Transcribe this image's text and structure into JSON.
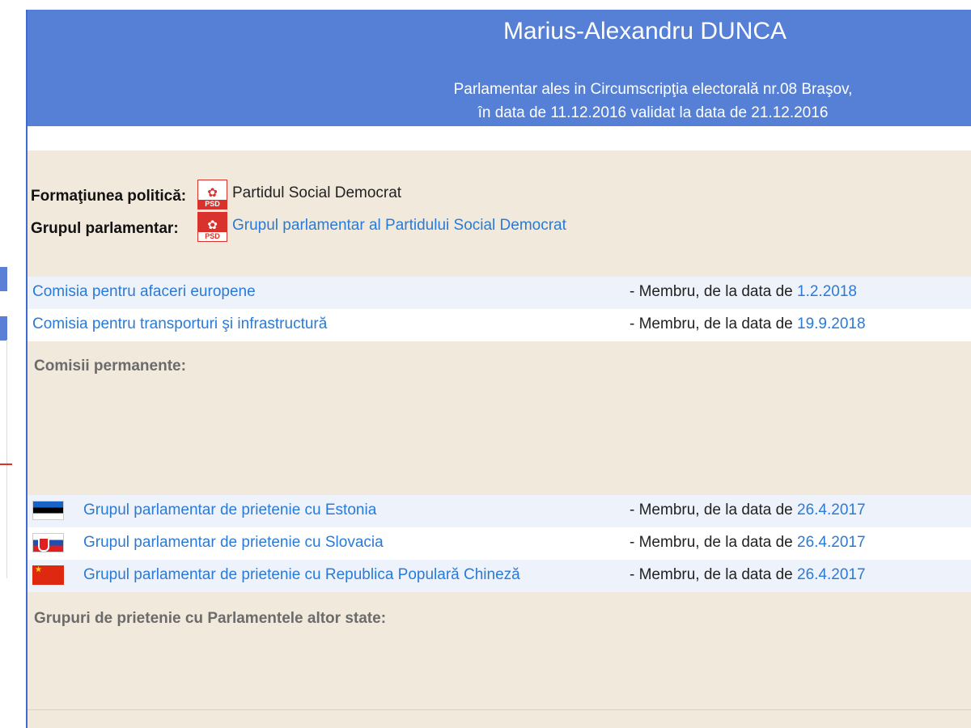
{
  "header": {
    "name": "Marius-Alexandru DUNCA",
    "subtitle_line1": "Parlamentar ales in Circumscripţia electorală nr.08 Braşov,",
    "subtitle_line2": "în data de 11.12.2016 validat la data de 21.12.2016"
  },
  "party": {
    "formation_label": "Formaţiunea politică:",
    "formation_value": "Partidul Social Democrat",
    "group_label": "Grupul parlamentar:",
    "group_value": "Grupul parlamentar al Partidului Social Democrat",
    "logo_text": "PSD",
    "logo_icon": "rose-icon"
  },
  "commissions": {
    "rows": [
      {
        "name": "Comisia pentru afaceri europene",
        "role": "- Membru, de la data de ",
        "date": "1.2.2018"
      },
      {
        "name": "Comisia pentru transporturi şi infrastructură",
        "role": "- Membru, de la data de ",
        "date": "19.9.2018"
      }
    ],
    "title": "Comisii permanente:"
  },
  "friendship": {
    "rows": [
      {
        "flag": "estonia-flag-icon",
        "name": "Grupul parlamentar de prietenie cu Estonia",
        "role": "- Membru, de la data de ",
        "date": "26.4.2017"
      },
      {
        "flag": "slovakia-flag-icon",
        "name": "Grupul parlamentar de prietenie cu Slovacia",
        "role": "- Membru, de la data de ",
        "date": "26.4.2017"
      },
      {
        "flag": "china-flag-icon",
        "name": "Grupul parlamentar de prietenie cu Republica Populară Chineză",
        "role": "- Membru, de la data de ",
        "date": "26.4.2017"
      }
    ],
    "title": "Grupuri de prietenie cu Parlamentele altor state:"
  },
  "colors": {
    "header_bg": "#5580d6",
    "content_bg": "#f0e9dc",
    "link": "#2a7ad8",
    "psd_red": "#d9312b"
  }
}
